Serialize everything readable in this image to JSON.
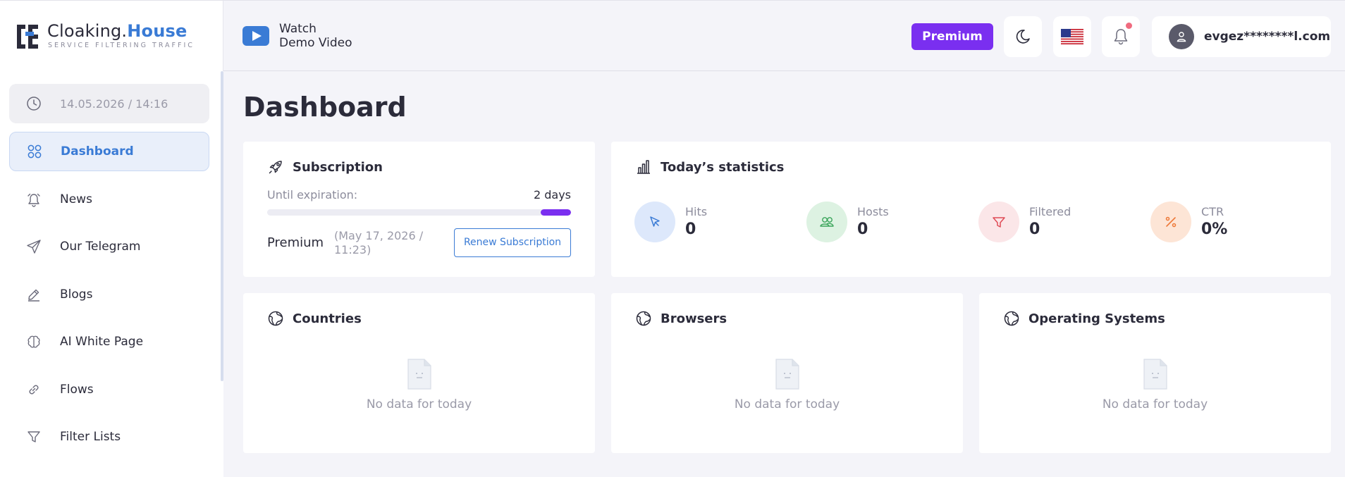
{
  "header": {
    "logo_brand": "Cloaking.",
    "logo_brand_accent": "House",
    "logo_tagline": "SERVICE FILTERING TRAFFIC",
    "watch_line1": "Watch",
    "watch_line2": "Demo Video",
    "premium_label": "Premium",
    "user_email": "evgez********l.com"
  },
  "sidebar": {
    "datetime": "14.05.2026 / 14:16",
    "items": [
      {
        "label": "Dashboard",
        "icon": "grid-icon",
        "active": true
      },
      {
        "label": "News",
        "icon": "alarm-icon"
      },
      {
        "label": "Our Telegram",
        "icon": "send-icon"
      },
      {
        "label": "Blogs",
        "icon": "edit-icon"
      },
      {
        "label": "AI White Page",
        "icon": "brain-icon"
      },
      {
        "label": "Flows",
        "icon": "link-icon"
      },
      {
        "label": "Filter Lists",
        "icon": "filter-icon"
      }
    ]
  },
  "main": {
    "title": "Dashboard",
    "subscription": {
      "title": "Subscription",
      "until_label": "Until expiration:",
      "until_value": "2 days",
      "progress_fraction": 0.1,
      "plan": "Premium",
      "plan_date": "(May 17, 2026 / 11:23)",
      "renew_label": "Renew Subscription"
    },
    "stats": {
      "title": "Today’s statistics",
      "items": [
        {
          "label": "Hits",
          "value": "0",
          "color": "#3a7bd5",
          "bg": "#dde8fb"
        },
        {
          "label": "Hosts",
          "value": "0",
          "color": "#3aa55a",
          "bg": "#ddf2e2"
        },
        {
          "label": "Filtered",
          "value": "0",
          "color": "#e04a55",
          "bg": "#fbe6e8"
        },
        {
          "label": "CTR",
          "value": "0%",
          "color": "#ee7a3a",
          "bg": "#fde5d6"
        }
      ]
    },
    "cards": [
      {
        "title": "Countries",
        "empty": "No data for today"
      },
      {
        "title": "Browsers",
        "empty": "No data for today"
      },
      {
        "title": "Operating Systems",
        "empty": "No data for today"
      }
    ]
  },
  "colors": {
    "accent": "#3a7bd5",
    "premium": "#7a2ff0"
  }
}
